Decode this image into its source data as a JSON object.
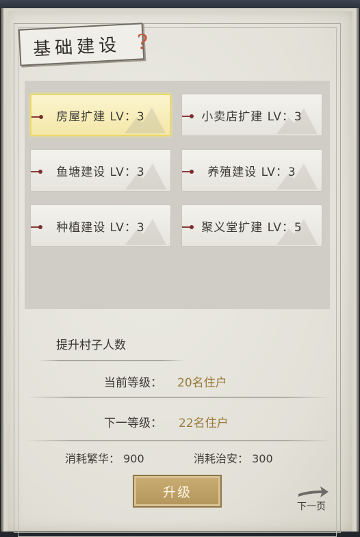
{
  "title": "基础建设",
  "help_icon": "question-mark-icon",
  "buildings": [
    {
      "label": "房屋扩建 LV：3",
      "selected": true
    },
    {
      "label": "小卖店扩建 LV：3",
      "selected": false
    },
    {
      "label": "鱼塘建设 LV：3",
      "selected": false
    },
    {
      "label": "养殖建设 LV：3",
      "selected": false
    },
    {
      "label": "种植建设 LV：3",
      "selected": false
    },
    {
      "label": "聚义堂扩建 LV：5",
      "selected": false
    }
  ],
  "detail": {
    "description": "提升村子人数",
    "current_label": "当前等级：",
    "current_value": "20名住户",
    "next_label": "下一等级：",
    "next_value": "22名住户",
    "cost_prosperity_label": "消耗繁华：",
    "cost_prosperity_value": "900",
    "cost_security_label": "消耗治安：",
    "cost_security_value": "300"
  },
  "upgrade_label": "升级",
  "next_page_label": "下一页",
  "colors": {
    "selected_bg": "#f3e7a8",
    "value_gold": "#9a7a3c",
    "upgrade_bg": "#b3955b"
  }
}
